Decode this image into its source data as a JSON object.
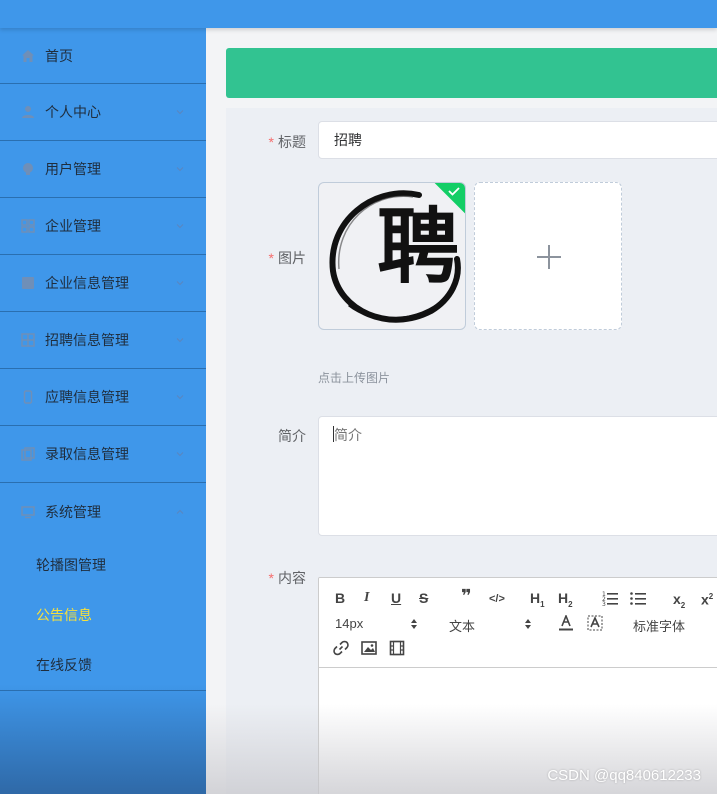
{
  "sidebar": {
    "items": [
      {
        "label": "首页"
      },
      {
        "label": "个人中心"
      },
      {
        "label": "用户管理"
      },
      {
        "label": "企业管理"
      },
      {
        "label": "企业信息管理"
      },
      {
        "label": "招聘信息管理"
      },
      {
        "label": "应聘信息管理"
      },
      {
        "label": "录取信息管理"
      },
      {
        "label": "系统管理"
      }
    ],
    "sub_items": [
      {
        "label": "轮播图管理"
      },
      {
        "label": "公告信息"
      },
      {
        "label": "在线反馈"
      }
    ]
  },
  "form": {
    "title": {
      "label": "标题",
      "required": "*",
      "value": "招聘"
    },
    "image": {
      "label": "图片",
      "required": "*",
      "thumb_text": "聘",
      "tip": "点击上传图片"
    },
    "intro": {
      "label": "简介",
      "placeholder": "简介"
    },
    "content": {
      "label": "内容",
      "required": "*"
    }
  },
  "editor": {
    "bold": "B",
    "italic": "I",
    "underline": "U",
    "strike": "S",
    "quote": "❞",
    "code": "</>",
    "h1": "H",
    "h1_sub": "1",
    "h2": "H",
    "h2_sub": "2",
    "sub": "x",
    "sub_mark": "2",
    "sup": "x",
    "sup_mark": "2",
    "font_size": "14px",
    "block_type": "文本",
    "font_family": "标准字体"
  },
  "watermark": "CSDN @qq840612233",
  "colors": {
    "sidebar": "#3f97ea",
    "banner": "#32c391",
    "active": "#f7e03c",
    "required": "#f56c6c"
  }
}
